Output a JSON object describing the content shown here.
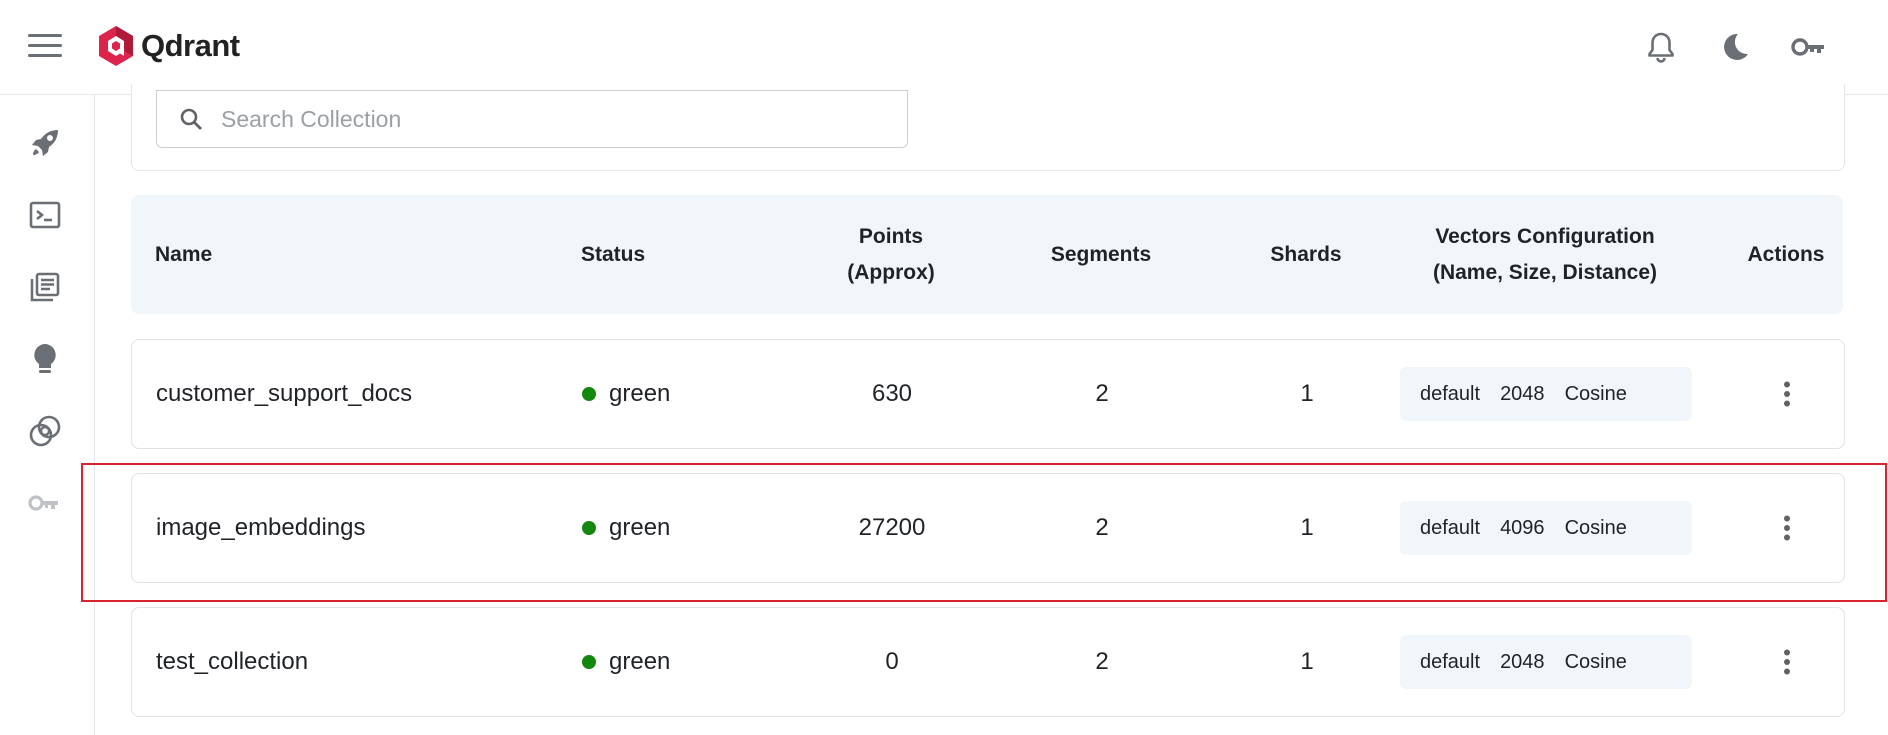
{
  "app": {
    "brand_name": "Qdrant",
    "brand_color": "#dc244c"
  },
  "header": {
    "icons": [
      "menu-icon",
      "bell-icon",
      "moon-icon",
      "key-icon"
    ]
  },
  "sidebar": {
    "items": [
      {
        "icon": "rocket-icon"
      },
      {
        "icon": "terminal-icon"
      },
      {
        "icon": "library-icon"
      },
      {
        "icon": "lightbulb-icon"
      },
      {
        "icon": "rings-icon"
      },
      {
        "icon": "key-icon"
      }
    ]
  },
  "search": {
    "placeholder": "Search Collection",
    "value": ""
  },
  "table": {
    "headers": {
      "name": "Name",
      "status": "Status",
      "points_line1": "Points",
      "points_line2": "(Approx)",
      "segments": "Segments",
      "shards": "Shards",
      "vectors_line1": "Vectors Configuration",
      "vectors_line2": "(Name, Size, Distance)",
      "actions": "Actions"
    },
    "rows": [
      {
        "name": "customer_support_docs",
        "status": "green",
        "points": "630",
        "segments": "2",
        "shards": "1",
        "vector_name": "default",
        "vector_size": "2048",
        "distance": "Cosine"
      },
      {
        "name": "image_embeddings",
        "status": "green",
        "points": "27200",
        "segments": "2",
        "shards": "1",
        "vector_name": "default",
        "vector_size": "4096",
        "distance": "Cosine"
      },
      {
        "name": "test_collection",
        "status": "green",
        "points": "0",
        "segments": "2",
        "shards": "1",
        "vector_name": "default",
        "vector_size": "2048",
        "distance": "Cosine"
      }
    ]
  },
  "colors": {
    "status_green": "#14870f",
    "highlight": "#d9232e",
    "header_bg": "#f1f6fa"
  }
}
